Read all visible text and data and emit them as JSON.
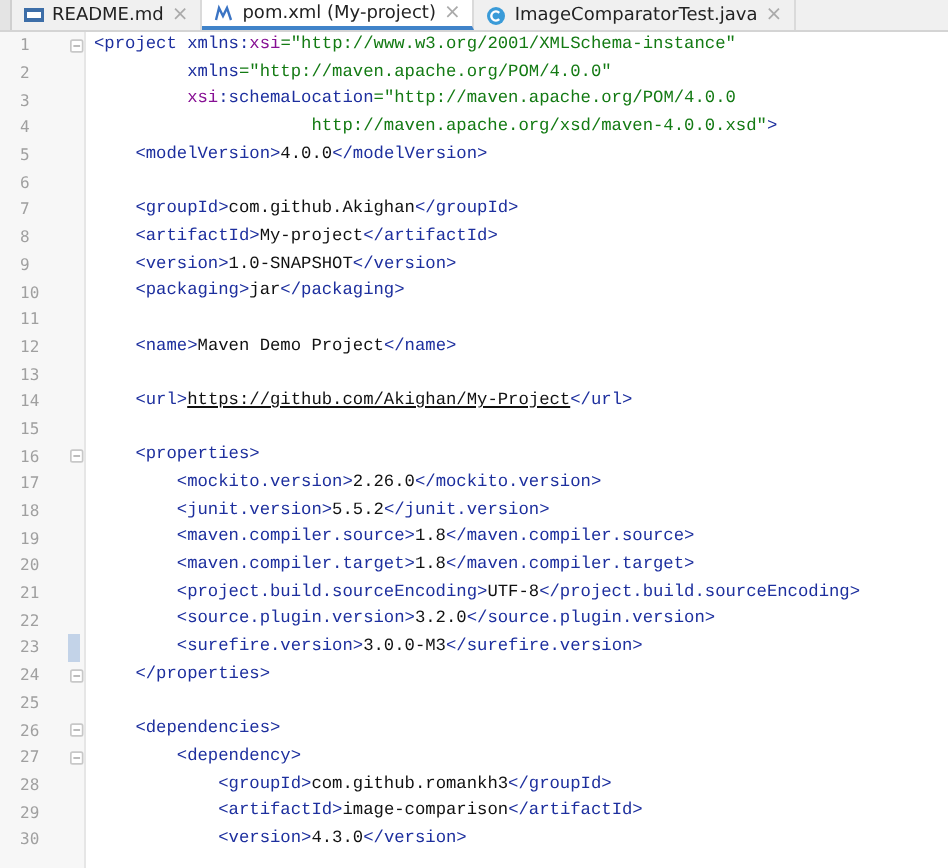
{
  "tabs": [
    {
      "label": "README.md",
      "kind": "markdown",
      "close": "×",
      "selected": false
    },
    {
      "label": "pom.xml (My-project)",
      "kind": "maven",
      "close": "×",
      "selected": true
    },
    {
      "label": "ImageComparatorTest.java",
      "kind": "java",
      "close": "×",
      "selected": false
    }
  ],
  "editor": {
    "lines": [
      {
        "number": "1",
        "foldable": true,
        "changed": false,
        "tokens": [
          {
            "kind": "tag",
            "text": "<project"
          },
          {
            "kind": "attr",
            "text": " xmlns:"
          },
          {
            "kind": "ns",
            "text": "xsi"
          },
          {
            "kind": "value",
            "text": "=\"http://www.w3.org/2001/XMLSchema-instance\""
          }
        ]
      },
      {
        "number": "2",
        "foldable": false,
        "changed": false,
        "tokens": [
          {
            "kind": "attr",
            "text": "         xmlns"
          },
          {
            "kind": "value",
            "text": "=\"http://maven.apache.org/POM/4.0.0\""
          }
        ]
      },
      {
        "number": "3",
        "foldable": false,
        "changed": false,
        "tokens": [
          {
            "kind": "ns",
            "text": "         xsi"
          },
          {
            "kind": "attr",
            "text": ":schemaLocation"
          },
          {
            "kind": "value",
            "text": "=\"http://maven.apache.org/POM/4.0.0"
          }
        ]
      },
      {
        "number": "4",
        "foldable": false,
        "changed": false,
        "tokens": [
          {
            "kind": "value",
            "text": "                     http://maven.apache.org/xsd/maven-4.0.0.xsd\""
          },
          {
            "kind": "tag",
            "text": ">"
          }
        ]
      },
      {
        "number": "5",
        "foldable": false,
        "changed": false,
        "tokens": [
          {
            "kind": "tag",
            "text": "    <modelVersion>"
          },
          {
            "kind": "text",
            "text": "4.0.0"
          },
          {
            "kind": "tag",
            "text": "</modelVersion>"
          }
        ]
      },
      {
        "number": "6",
        "foldable": false,
        "changed": false
      },
      {
        "number": "7",
        "foldable": false,
        "changed": false,
        "tokens": [
          {
            "kind": "tag",
            "text": "    <groupId>"
          },
          {
            "kind": "text",
            "text": "com.github.Akighan"
          },
          {
            "kind": "tag",
            "text": "</groupId>"
          }
        ]
      },
      {
        "number": "8",
        "foldable": false,
        "changed": false,
        "tokens": [
          {
            "kind": "tag",
            "text": "    <artifactId>"
          },
          {
            "kind": "text",
            "text": "My-project"
          },
          {
            "kind": "tag",
            "text": "</artifactId>"
          }
        ]
      },
      {
        "number": "9",
        "foldable": false,
        "changed": false,
        "tokens": [
          {
            "kind": "tag",
            "text": "    <version>"
          },
          {
            "kind": "text",
            "text": "1.0-SNAPSHOT"
          },
          {
            "kind": "tag",
            "text": "</version>"
          }
        ]
      },
      {
        "number": "10",
        "foldable": false,
        "changed": false,
        "tokens": [
          {
            "kind": "tag",
            "text": "    <packaging>"
          },
          {
            "kind": "text",
            "text": "jar"
          },
          {
            "kind": "tag",
            "text": "</packaging>"
          }
        ]
      },
      {
        "number": "11",
        "foldable": false,
        "changed": false
      },
      {
        "number": "12",
        "foldable": false,
        "changed": false,
        "tokens": [
          {
            "kind": "tag",
            "text": "    <name>"
          },
          {
            "kind": "text",
            "text": "Maven Demo Project"
          },
          {
            "kind": "tag",
            "text": "</name>"
          }
        ]
      },
      {
        "number": "13",
        "foldable": false,
        "changed": false
      },
      {
        "number": "14",
        "foldable": false,
        "changed": false,
        "tokens": [
          {
            "kind": "tag",
            "text": "    <url>"
          },
          {
            "kind": "link",
            "text": "https://github.com/Akighan/My-Project"
          },
          {
            "kind": "tag",
            "text": "</url>"
          }
        ]
      },
      {
        "number": "15",
        "foldable": false,
        "changed": false
      },
      {
        "number": "16",
        "foldable": true,
        "changed": false,
        "tokens": [
          {
            "kind": "tag",
            "text": "    <properties>"
          }
        ]
      },
      {
        "number": "17",
        "foldable": false,
        "changed": false,
        "tokens": [
          {
            "kind": "tag",
            "text": "        <mockito.version>"
          },
          {
            "kind": "text",
            "text": "2.26.0"
          },
          {
            "kind": "tag",
            "text": "</mockito.version>"
          }
        ]
      },
      {
        "number": "18",
        "foldable": false,
        "changed": false,
        "tokens": [
          {
            "kind": "tag",
            "text": "        <junit.version>"
          },
          {
            "kind": "text",
            "text": "5.5.2"
          },
          {
            "kind": "tag",
            "text": "</junit.version>"
          }
        ]
      },
      {
        "number": "19",
        "foldable": false,
        "changed": false,
        "tokens": [
          {
            "kind": "tag",
            "text": "        <maven.compiler.source>"
          },
          {
            "kind": "text",
            "text": "1.8"
          },
          {
            "kind": "tag",
            "text": "</maven.compiler.source>"
          }
        ]
      },
      {
        "number": "20",
        "foldable": false,
        "changed": false,
        "tokens": [
          {
            "kind": "tag",
            "text": "        <maven.compiler.target>"
          },
          {
            "kind": "text",
            "text": "1.8"
          },
          {
            "kind": "tag",
            "text": "</maven.compiler.target>"
          }
        ]
      },
      {
        "number": "21",
        "foldable": false,
        "changed": false,
        "tokens": [
          {
            "kind": "tag",
            "text": "        <project.build.sourceEncoding>"
          },
          {
            "kind": "text",
            "text": "UTF-8"
          },
          {
            "kind": "tag",
            "text": "</project.build.sourceEncoding>"
          }
        ]
      },
      {
        "number": "22",
        "foldable": false,
        "changed": false,
        "tokens": [
          {
            "kind": "tag",
            "text": "        <source.plugin.version>"
          },
          {
            "kind": "text",
            "text": "3.2.0"
          },
          {
            "kind": "tag",
            "text": "</source.plugin.version>"
          }
        ]
      },
      {
        "number": "23",
        "foldable": false,
        "changed": true,
        "tokens": [
          {
            "kind": "tag",
            "text": "        <surefire.version>"
          },
          {
            "kind": "text",
            "text": "3.0.0-M3"
          },
          {
            "kind": "tag",
            "text": "</surefire.version>"
          }
        ]
      },
      {
        "number": "24",
        "foldable": true,
        "changed": false,
        "tokens": [
          {
            "kind": "tag",
            "text": "    </properties>"
          }
        ]
      },
      {
        "number": "25",
        "foldable": false,
        "changed": false
      },
      {
        "number": "26",
        "foldable": true,
        "changed": false,
        "tokens": [
          {
            "kind": "tag",
            "text": "    <dependencies>"
          }
        ]
      },
      {
        "number": "27",
        "foldable": true,
        "changed": false,
        "tokens": [
          {
            "kind": "tag",
            "text": "        <dependency>"
          }
        ]
      },
      {
        "number": "28",
        "foldable": false,
        "changed": false,
        "tokens": [
          {
            "kind": "tag",
            "text": "            <groupId>"
          },
          {
            "kind": "text",
            "text": "com.github.romankh3"
          },
          {
            "kind": "tag",
            "text": "</groupId>"
          }
        ]
      },
      {
        "number": "29",
        "foldable": false,
        "changed": false,
        "tokens": [
          {
            "kind": "tag",
            "text": "            <artifactId>"
          },
          {
            "kind": "text",
            "text": "image-comparison"
          },
          {
            "kind": "tag",
            "text": "</artifactId>"
          }
        ]
      },
      {
        "number": "30",
        "foldable": false,
        "changed": false,
        "tokens": [
          {
            "kind": "tag",
            "text": "            <version>"
          },
          {
            "kind": "text",
            "text": "4.3.0"
          },
          {
            "kind": "tag",
            "text": "</version>"
          }
        ]
      }
    ]
  }
}
